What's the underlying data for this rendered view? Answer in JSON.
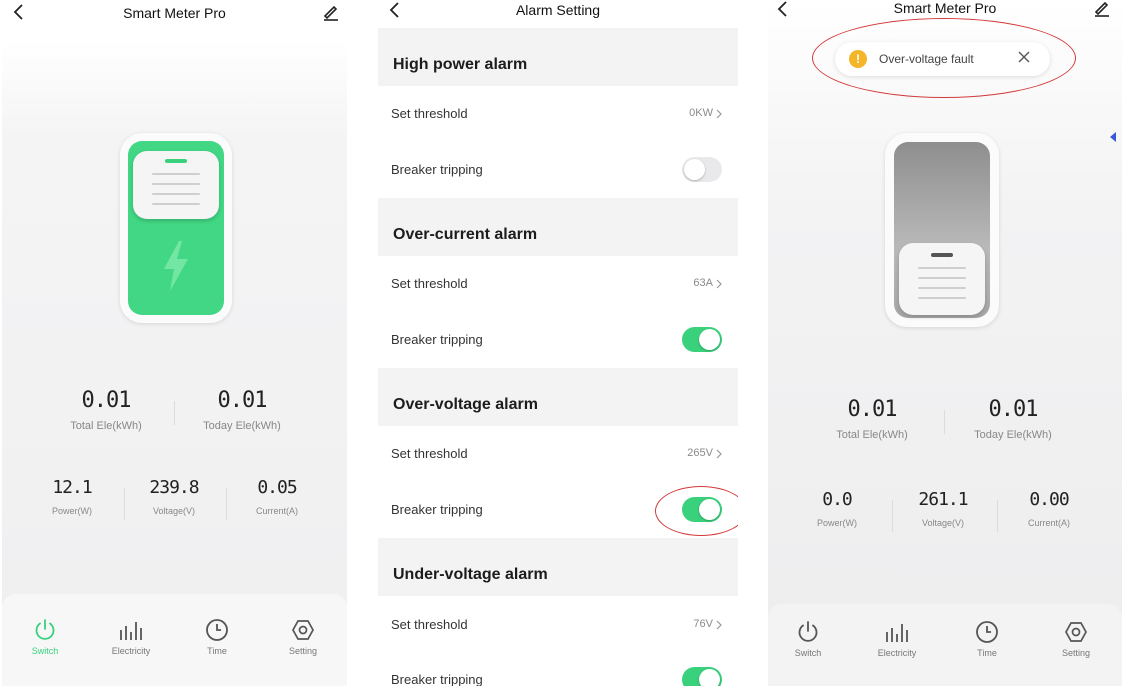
{
  "app": {
    "title": "Smart Meter Pro",
    "settings_title": "Alarm Setting"
  },
  "left_screen": {
    "total_ele_value": "0.01",
    "total_ele_label": "Total Ele(kWh)",
    "today_ele_value": "0.01",
    "today_ele_label": "Today Ele(kWh)",
    "power_value": "12.1",
    "power_label": "Power(W)",
    "voltage_value": "239.8",
    "voltage_label": "Voltage(V)",
    "current_value": "0.05",
    "current_label": "Current(A)",
    "switch_state": "on"
  },
  "right_screen": {
    "toast_text": "Over-voltage fault",
    "total_ele_value": "0.01",
    "total_ele_label": "Total Ele(kWh)",
    "today_ele_value": "0.01",
    "today_ele_label": "Today Ele(kWh)",
    "power_value": "0.0",
    "power_label": "Power(W)",
    "voltage_value": "261.1",
    "voltage_label": "Voltage(V)",
    "current_value": "0.00",
    "current_label": "Current(A)",
    "switch_state": "off"
  },
  "tabs": {
    "switch": "Switch",
    "electricity": "Electricity",
    "time": "Time",
    "setting": "Setting",
    "active_left": "Switch"
  },
  "alarms": {
    "high_power": {
      "title": "High power alarm",
      "threshold_label": "Set threshold",
      "threshold_value": "0KW",
      "tripping_label": "Breaker tripping",
      "tripping": false
    },
    "over_current": {
      "title": "Over-current alarm",
      "threshold_label": "Set threshold",
      "threshold_value": "63A",
      "tripping_label": "Breaker tripping",
      "tripping": true
    },
    "over_voltage": {
      "title": "Over-voltage alarm",
      "threshold_label": "Set threshold",
      "threshold_value": "265V",
      "tripping_label": "Breaker tripping",
      "tripping": true
    },
    "under_voltage": {
      "title": "Under-voltage alarm",
      "threshold_label": "Set threshold",
      "threshold_value": "76V",
      "tripping_label": "Breaker tripping",
      "tripping": true
    }
  },
  "colors": {
    "accent_green": "#39d17c",
    "warning_amber": "#f4b529",
    "highlight_red": "#d33a3a",
    "switch_off": "#e9e9eb"
  },
  "icons": [
    "back-arrow-icon",
    "edit-icon",
    "power-icon",
    "bar-chart-icon",
    "clock-icon",
    "gear-icon",
    "lightning-icon",
    "warning-icon",
    "close-icon",
    "chevron-right-icon"
  ]
}
